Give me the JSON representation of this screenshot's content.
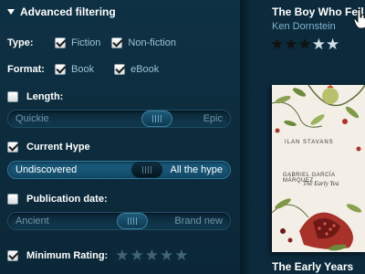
{
  "filters": {
    "header": {
      "title": "Advanced filtering"
    },
    "type": {
      "label": "Type:",
      "options": [
        {
          "label": "Fiction",
          "checked": true
        },
        {
          "label": "Non-fiction",
          "checked": true
        }
      ]
    },
    "format": {
      "label": "Format:",
      "options": [
        {
          "label": "Book",
          "checked": true
        },
        {
          "label": "eBook",
          "checked": true
        }
      ]
    },
    "length": {
      "label": "Length:",
      "checked": false,
      "slider": {
        "min_label": "Quickie",
        "max_label": "Epic",
        "value": 0.7
      }
    },
    "hype": {
      "label": "Current Hype",
      "checked": true,
      "slider": {
        "min_label": "Undiscovered",
        "max_label": "All the hype",
        "value": 0.65
      }
    },
    "pubdate": {
      "label": "Publication date:",
      "checked": false,
      "slider": {
        "min_label": "Ancient",
        "max_label": "Brand new",
        "value": 0.57
      }
    },
    "rating": {
      "label": "Minimum Rating:",
      "checked": true,
      "value": 0,
      "max": 5
    }
  },
  "results": {
    "book1": {
      "title": "The Boy Who Fell",
      "author": "Ken Dornstein",
      "rating": 3,
      "max": 5
    },
    "book2": {
      "title": "The Early Years",
      "cover": {
        "intro_author": "ILAN STAVANS",
        "byline": "GABRIEL GARCÍA MÁRQUEZ",
        "title": "The Early Yea"
      }
    }
  },
  "colors": {
    "panel_bg": "#0e3144",
    "accent": "#1b5d80",
    "link": "#7fb6d1"
  }
}
